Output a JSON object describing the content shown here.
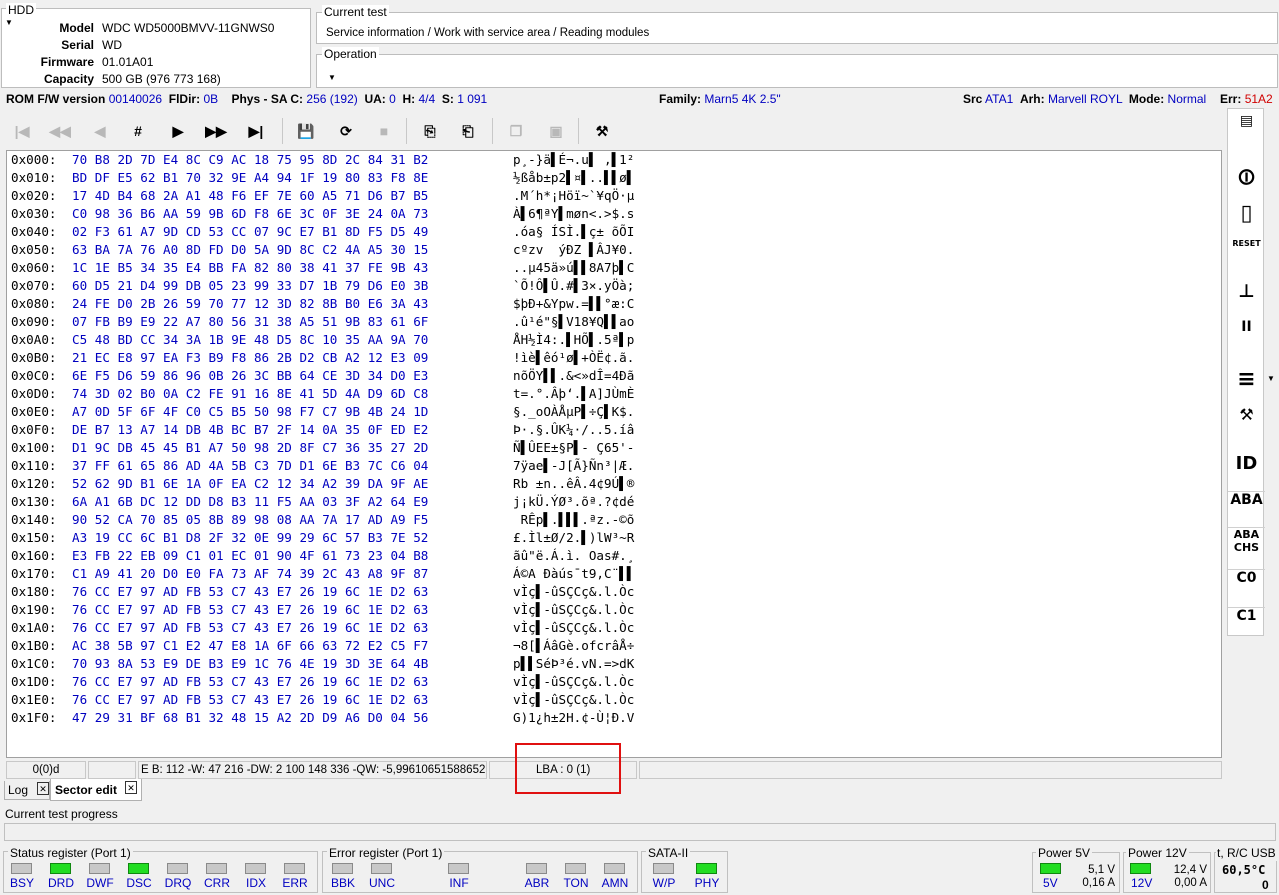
{
  "hdd": {
    "title": "HDD",
    "model_label": "Model",
    "model_value": "WDC WD5000BMVV-11GNWS0",
    "serial_label": "Serial",
    "serial_value": "WD",
    "firmware_label": "Firmware",
    "firmware_value": "01.01A01",
    "capacity_label": "Capacity",
    "capacity_value": "500 GB (976 773 168)"
  },
  "current_test": {
    "title": "Current test",
    "value": "Service information / Work with service area / Reading modules"
  },
  "operation": {
    "title": "Operation"
  },
  "info_bar": {
    "rom_label": "ROM F/W version",
    "rom_value": "00140026",
    "fldir_label": "FlDir:",
    "fldir_value": "0B",
    "phys_label": "Phys - SA C:",
    "phys_value": "256 (192)",
    "ua_label": "UA:",
    "ua_value": "0",
    "h_label": "H:",
    "h_value": "4/4",
    "s_label": "S:",
    "s_value": "1 091",
    "family_label": "Family:",
    "family_value": "Marn5 4K 2.5\"",
    "src_label": "Src",
    "src_value": "ATA1",
    "arh_label": "Arh:",
    "arh_value": "Marvell ROYL",
    "mode_label": "Mode:",
    "mode_value": "Normal",
    "err_label": "Err:",
    "err_value": "51A2"
  },
  "toolbar": [
    {
      "name": "first-icon",
      "glyph": "|◀",
      "dis": true
    },
    {
      "name": "prev-fast-icon",
      "glyph": "◀◀",
      "dis": true
    },
    {
      "name": "prev-icon",
      "glyph": "◀",
      "dis": true
    },
    {
      "name": "goto-sector-icon",
      "glyph": "#",
      "dis": false
    },
    {
      "name": "next-icon",
      "glyph": "▶",
      "dis": false
    },
    {
      "name": "next-fast-icon",
      "glyph": "▶▶",
      "dis": false
    },
    {
      "name": "last-icon",
      "glyph": "▶|",
      "dis": false
    },
    {
      "name": "save-disk-icon",
      "glyph": "💾",
      "dis": true
    },
    {
      "name": "refresh-icon",
      "glyph": "⟳",
      "dis": false
    },
    {
      "name": "stop-icon",
      "glyph": "■",
      "dis": true
    },
    {
      "name": "save-file-icon",
      "glyph": "⎘",
      "dis": false
    },
    {
      "name": "load-file-icon",
      "glyph": "⎗",
      "dis": false
    },
    {
      "name": "copy-icon",
      "glyph": "❐",
      "dis": true
    },
    {
      "name": "paste-icon",
      "glyph": "▣",
      "dis": true
    },
    {
      "name": "tools-icon",
      "glyph": "⚒",
      "dis": false
    }
  ],
  "hex": [
    {
      "off": "0x000:",
      "bytes": "70 B8 2D 7D E4 8C C9 AC 18 75 95 8D 2C 84 31 B2",
      "ascii": "p¸-}ä▌É¬.u▌ ,▌1²"
    },
    {
      "off": "0x010:",
      "bytes": "BD DF E5 62 B1 70 32 9E A4 94 1F 19 80 83 F8 8E",
      "ascii": "½ßåb±p2▌¤▌..▌▌ø▌"
    },
    {
      "off": "0x020:",
      "bytes": "17 4D B4 68 2A A1 48 F6 EF 7E 60 A5 71 D6 B7 B5",
      "ascii": ".M´h*¡Höï~`¥qÖ·µ"
    },
    {
      "off": "0x030:",
      "bytes": "C0 98 36 B6 AA 59 9B 6D F8 6E 3C 0F 3E 24 0A 73",
      "ascii": "À▌6¶ªY▌møn<.>$.s"
    },
    {
      "off": "0x040:",
      "bytes": "02 F3 61 A7 9D CD 53 CC 07 9C E7 B1 8D F5 D5 49",
      "ascii": ".óa§ ÍSÌ.▌ç± õÕI"
    },
    {
      "off": "0x050:",
      "bytes": "63 BA 7A 76 A0 8D FD D0 5A 9D 8C C2 4A A5 30 15",
      "ascii": "cºzv  ýÐZ ▌ÂJ¥0."
    },
    {
      "off": "0x060:",
      "bytes": "1C 1E B5 34 35 E4 BB FA 82 80 38 41 37 FE 9B 43",
      "ascii": "..µ45ä»ú▌▌8A7þ▌C"
    },
    {
      "off": "0x070:",
      "bytes": "60 D5 21 D4 99 DB 05 23 99 33 D7 1B 79 D6 E0 3B",
      "ascii": "`Õ!Ô▌Û.#▌3×.yÖà;"
    },
    {
      "off": "0x080:",
      "bytes": "24 FE D0 2B 26 59 70 77 12 3D 82 8B B0 E6 3A 43",
      "ascii": "$þÐ+&Ypw.=▌▌°æ:C"
    },
    {
      "off": "0x090:",
      "bytes": "07 FB B9 E9 22 A7 80 56 31 38 A5 51 9B 83 61 6F",
      "ascii": ".û¹é\"§▌V18¥Q▌▌ao"
    },
    {
      "off": "0x0A0:",
      "bytes": "C5 48 BD CC 34 3A 1B 9E 48 D5 8C 10 35 AA 9A 70",
      "ascii": "ÅH½Ì4:.▌HÕ▌.5ª▌p"
    },
    {
      "off": "0x0B0:",
      "bytes": "21 EC E8 97 EA F3 B9 F8 86 2B D2 CB A2 12 E3 09",
      "ascii": "!ìè▌êó¹ø▌+ÒË¢.ã."
    },
    {
      "off": "0x0C0:",
      "bytes": "6E F5 D6 59 86 96 0B 26 3C BB 64 CE 3D 34 D0 E3",
      "ascii": "nõÖY▌▌.&<»dÎ=4Ðã"
    },
    {
      "off": "0x0D0:",
      "bytes": "74 3D 02 B0 0A C2 FE 91 16 8E 41 5D 4A D9 6D C8",
      "ascii": "t=.°.Âþ‘.▌A]JÙmÈ"
    },
    {
      "off": "0x0E0:",
      "bytes": "A7 0D 5F 6F 4F C0 C5 B5 50 98 F7 C7 9B 4B 24 1D",
      "ascii": "§._oOÀÅµP▌÷Ç▌K$."
    },
    {
      "off": "0x0F0:",
      "bytes": "DE B7 13 A7 14 DB 4B BC B7 2F 14 0A 35 0F ED E2",
      "ascii": "Þ·.§.ÛK¼·/..5.íâ"
    },
    {
      "off": "0x100:",
      "bytes": "D1 9C DB 45 45 B1 A7 50 98 2D 8F C7 36 35 27 2D",
      "ascii": "Ñ▌ÛEE±§P▌- Ç65'-"
    },
    {
      "off": "0x110:",
      "bytes": "37 FF 61 65 86 AD 4A 5B C3 7D D1 6E B3 7C C6 04",
      "ascii": "7ÿae▌-J[Ã}Ñn³|Æ."
    },
    {
      "off": "0x120:",
      "bytes": "52 62 9D B1 6E 1A 0F EA C2 12 34 A2 39 DA 9F AE",
      "ascii": "Rb ±n..êÂ.4¢9Ú▌®"
    },
    {
      "off": "0x130:",
      "bytes": "6A A1 6B DC 12 DD D8 B3 11 F5 AA 03 3F A2 64 E9",
      "ascii": "j¡kÜ.ÝØ³.õª.?¢dé"
    },
    {
      "off": "0x140:",
      "bytes": "90 52 CA 70 85 05 8B 89 98 08 AA 7A 17 AD A9 F5",
      "ascii": " RÊp▌.▌▌▌.ªz.-©õ"
    },
    {
      "off": "0x150:",
      "bytes": "A3 19 CC 6C B1 D8 2F 32 0E 99 29 6C 57 B3 7E 52",
      "ascii": "£.Ìl±Ø/2.▌)lW³~R"
    },
    {
      "off": "0x160:",
      "bytes": "E3 FB 22 EB 09 C1 01 EC 01 90 4F 61 73 23 04 B8",
      "ascii": "ãû\"ë.Á.ì. Oas#.¸"
    },
    {
      "off": "0x170:",
      "bytes": "C1 A9 41 20 D0 E0 FA 73 AF 74 39 2C 43 A8 9F 87",
      "ascii": "Á©A Ðàús¯t9,C¨▌▌"
    },
    {
      "off": "0x180:",
      "bytes": "76 CC E7 97 AD FB 53 C7 43 E7 26 19 6C 1E D2 63",
      "ascii": "vÌç▌-ûSÇCç&.l.Òc"
    },
    {
      "off": "0x190:",
      "bytes": "76 CC E7 97 AD FB 53 C7 43 E7 26 19 6C 1E D2 63",
      "ascii": "vÌç▌-ûSÇCç&.l.Òc"
    },
    {
      "off": "0x1A0:",
      "bytes": "76 CC E7 97 AD FB 53 C7 43 E7 26 19 6C 1E D2 63",
      "ascii": "vÌç▌-ûSÇCç&.l.Òc"
    },
    {
      "off": "0x1B0:",
      "bytes": "AC 38 5B 97 C1 E2 47 E8 1A 6F 66 63 72 E2 C5 F7",
      "ascii": "¬8[▌ÁâGè.ofcrâÅ÷"
    },
    {
      "off": "0x1C0:",
      "bytes": "70 93 8A 53 E9 DE B3 E9 1C 76 4E 19 3D 3E 64 4B",
      "ascii": "p▌▌SéÞ³é.vN.=>dK"
    },
    {
      "off": "0x1D0:",
      "bytes": "76 CC E7 97 AD FB 53 C7 43 E7 26 19 6C 1E D2 63",
      "ascii": "vÌç▌-ûSÇCç&.l.Òc"
    },
    {
      "off": "0x1E0:",
      "bytes": "76 CC E7 97 AD FB 53 C7 43 E7 26 19 6C 1E D2 63",
      "ascii": "vÌç▌-ûSÇCç&.l.Òc"
    },
    {
      "off": "0x1F0:",
      "bytes": "47 29 31 BF 68 B1 32 48 15 A2 2D D9 A6 D0 04 56",
      "ascii": "G)1¿h±2H.¢-Ù¦Ð.V"
    }
  ],
  "status_bar": {
    "pos": "0(0)d",
    "values": "E B: 112 -W: 47 216 -DW: 2 100 148 336 -QW: -5,99610651588652E1",
    "lba": "LBA : 0 (1)"
  },
  "tabs": {
    "log": "Log",
    "sector_edit": "Sector edit",
    "close": "✕"
  },
  "progress_label": "Current test progress",
  "status_register": {
    "title": "Status register (Port 1)",
    "leds": [
      {
        "label": "BSY",
        "on": false
      },
      {
        "label": "DRD",
        "on": true
      },
      {
        "label": "DWF",
        "on": false
      },
      {
        "label": "DSC",
        "on": true
      },
      {
        "label": "DRQ",
        "on": false
      },
      {
        "label": "CRR",
        "on": false
      },
      {
        "label": "IDX",
        "on": false
      },
      {
        "label": "ERR",
        "on": false
      }
    ]
  },
  "error_register": {
    "title": "Error register (Port 1)",
    "leds": [
      {
        "label": "BBK",
        "on": false
      },
      {
        "label": "UNC",
        "on": false
      },
      {
        "label": "INF",
        "on": false
      },
      {
        "label": "ABR",
        "on": false
      },
      {
        "label": "TON",
        "on": false
      },
      {
        "label": "AMN",
        "on": false
      }
    ]
  },
  "sata": {
    "title": "SATA-II",
    "leds": [
      {
        "label": "W/P",
        "on": false
      },
      {
        "label": "PHY",
        "on": true
      }
    ]
  },
  "power5": {
    "title": "Power 5V",
    "label": "5V",
    "volt": "5,1 V",
    "amp": "0,16 A"
  },
  "power12": {
    "title": "Power 12V",
    "label": "12V",
    "volt": "12,4 V",
    "amp": "0,00 A"
  },
  "temp": {
    "title": "t, R/C USB",
    "value": "60,5°C",
    "count": "0"
  },
  "side_icons": [
    {
      "name": "terminal-icon",
      "glyph": "▤"
    },
    {
      "name": "power-switch-icon",
      "glyph": "⏼"
    },
    {
      "name": "phone-icon",
      "glyph": "▯"
    },
    {
      "name": "reset-icon",
      "glyph": "RESET"
    },
    {
      "name": "sleep-icon",
      "glyph": "⊥"
    },
    {
      "name": "pause-icon",
      "glyph": "II"
    },
    {
      "name": "stack-icon",
      "glyph": "≡"
    },
    {
      "name": "tools-side-icon",
      "glyph": "⚒"
    },
    {
      "name": "id-icon",
      "glyph": "ID"
    },
    {
      "name": "aba-icon",
      "glyph": "ABA"
    },
    {
      "name": "aba-chs-icon",
      "glyph": "ABA CHS"
    },
    {
      "name": "c0-icon",
      "glyph": "C0"
    },
    {
      "name": "c1-icon",
      "glyph": "C1"
    }
  ]
}
